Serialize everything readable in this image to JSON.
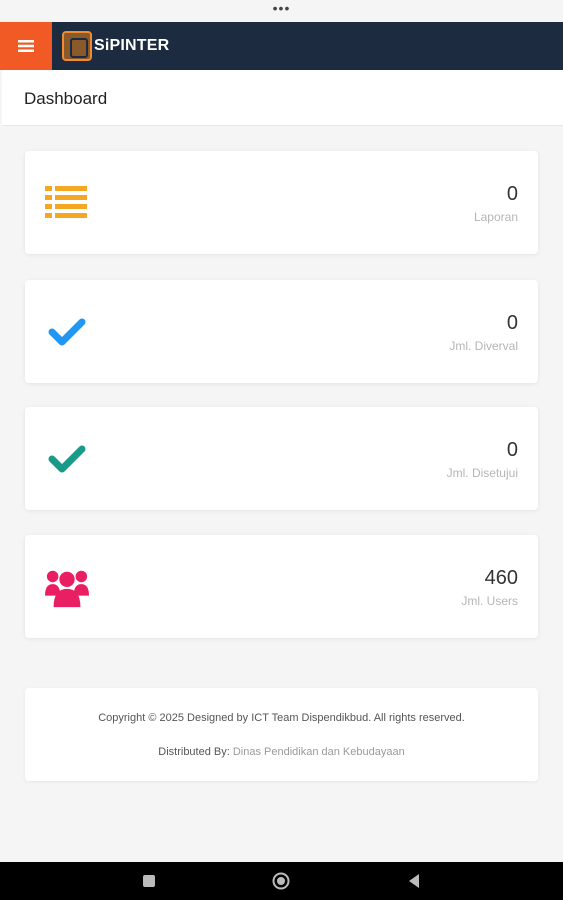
{
  "status_bar": {
    "dots": "•••"
  },
  "navbar": {
    "menu_icon": "hamburger-icon",
    "brand_name": "SiPINTER",
    "accent_color": "#f15a24",
    "background_color": "#1c2b3f"
  },
  "header": {
    "title": "Dashboard"
  },
  "cards": [
    {
      "value": "0",
      "label": "Laporan",
      "icon": "list-icon",
      "color": "#f5a623"
    },
    {
      "value": "0",
      "label": "Jml. Diverval",
      "icon": "check-icon",
      "color": "#2196f3"
    },
    {
      "value": "0",
      "label": "Jml. Disetujui",
      "icon": "check-icon",
      "color": "#1a9b8a"
    },
    {
      "value": "460",
      "label": "Jml. Users",
      "icon": "users-icon",
      "color": "#e91e63"
    }
  ],
  "footer": {
    "copyright": "Copyright © 2025 Designed by ICT Team Dispendikbud. All rights reserved.",
    "distributed_prefix": "Distributed By: ",
    "distributed_link": "Dinas Pendidikan dan Kebudayaan"
  },
  "system_nav": {
    "buttons": [
      "recents-icon",
      "home-icon",
      "back-icon"
    ]
  }
}
